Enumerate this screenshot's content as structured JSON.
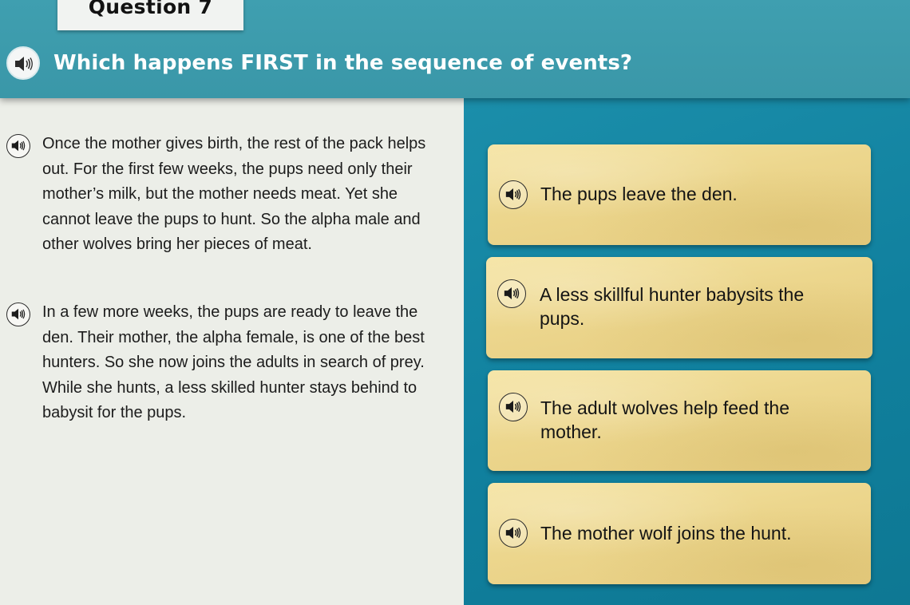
{
  "question": {
    "number_label": "Question 7",
    "prompt": "Which happens FIRST in the sequence of events?"
  },
  "passage": {
    "paragraphs": [
      "Once the mother gives birth, the rest of the pack helps out. For the first few weeks, the pups need only their mother’s milk, but the mother needs meat. Yet she cannot leave the pups to hunt. So the alpha male and other wolves bring her pieces of meat.",
      "In a few more weeks, the pups are ready to leave the den. Their mother, the alpha female, is one of the best hunters. So she now joins the adults in search of prey. While she hunts, a less skilled hunter stays behind to babysit for the pups."
    ]
  },
  "answers": [
    "The pups leave the den.",
    "A less skillful hunter babysits the pups.",
    "The adult wolves help feed the mother.",
    "The mother wolf joins the hunt."
  ],
  "icons": {
    "audio": "speaker-icon"
  },
  "colors": {
    "header": "#3f9fb0",
    "answer_panel": "#1b8eaa",
    "card": "#efdb94",
    "passage_bg": "#eceee8"
  }
}
